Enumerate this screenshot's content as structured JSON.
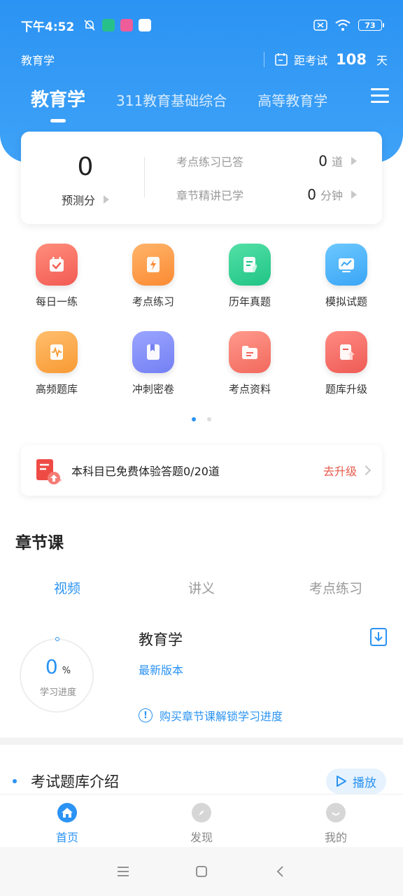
{
  "status_bar": {
    "time": "下午4:52",
    "battery": "73"
  },
  "header": {
    "subject": "教育学",
    "exam_label": "距考试",
    "days": "108",
    "days_unit": "天"
  },
  "tabs": [
    {
      "label": "教育学",
      "active": true
    },
    {
      "label": "311教育基础综合",
      "active": false
    },
    {
      "label": "高等教育学",
      "active": false
    }
  ],
  "score_card": {
    "score": "0",
    "score_label": "预测分",
    "stats": [
      {
        "label": "考点练习已答",
        "value": "0",
        "unit": "道"
      },
      {
        "label": "章节精讲已学",
        "value": "0",
        "unit": "分钟"
      }
    ]
  },
  "grid": [
    {
      "label": "每日一练",
      "icon": "calendar-check-icon",
      "color_from": "#ff8e7c",
      "color_to": "#f25a52"
    },
    {
      "label": "考点练习",
      "icon": "lightning-doc-icon",
      "color_from": "#ffb46a",
      "color_to": "#fb8a33"
    },
    {
      "label": "历年真题",
      "icon": "document-leaf-icon",
      "color_from": "#53e0a6",
      "color_to": "#20c486"
    },
    {
      "label": "模拟试题",
      "icon": "monitor-chart-icon",
      "color_from": "#6cc8ff",
      "color_to": "#3aa5f5"
    },
    {
      "label": "高频题库",
      "icon": "waveform-scroll-icon",
      "color_from": "#ffbe6d",
      "color_to": "#f89a34"
    },
    {
      "label": "冲刺密卷",
      "icon": "book-bookmark-icon",
      "color_from": "#9aa5ff",
      "color_to": "#7480f3"
    },
    {
      "label": "考点资料",
      "icon": "folder-icon",
      "color_from": "#ff9a8c",
      "color_to": "#f2685d"
    },
    {
      "label": "题库升级",
      "icon": "upgrade-doc-icon",
      "color_from": "#ff8b82",
      "color_to": "#ee5b55"
    }
  ],
  "pager": {
    "pages": 2,
    "current": 1
  },
  "banner": {
    "text": "本科目已免费体验答题0/20道",
    "cta": "去升级"
  },
  "chapter": {
    "title": "章节课",
    "tabs": [
      {
        "label": "视频",
        "active": true
      },
      {
        "label": "讲义",
        "active": false
      },
      {
        "label": "考点练习",
        "active": false
      }
    ],
    "progress_value": "0",
    "progress_unit": "%",
    "progress_label": "学习进度",
    "course_name": "教育学",
    "course_version": "最新版本",
    "buy_tip": "购买章节课解锁学习进度"
  },
  "intro": {
    "title": "考试题库介绍",
    "play": "播放"
  },
  "bottom_nav": [
    {
      "label": "首页",
      "icon": "home-icon",
      "active": true
    },
    {
      "label": "发现",
      "icon": "compass-icon",
      "active": false
    },
    {
      "label": "我的",
      "icon": "profile-icon",
      "active": false
    }
  ],
  "colors": {
    "primary": "#2b93f3",
    "accent_red": "#e55a4b"
  }
}
